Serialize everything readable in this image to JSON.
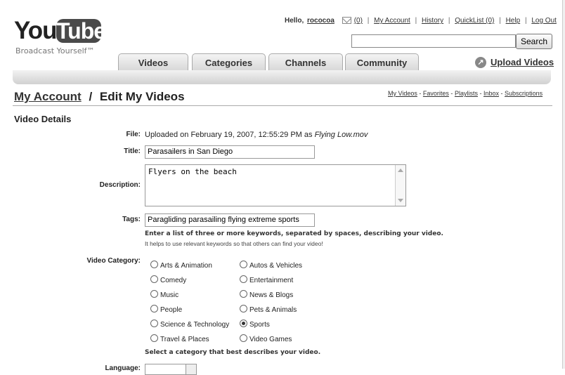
{
  "logo": {
    "part1": "You",
    "part2": "Tube",
    "tagline": "Broadcast Yourself™"
  },
  "user_bar": {
    "hello": "Hello,",
    "username": "rococoa",
    "inbox_count": "(0)",
    "links": [
      "My Account",
      "History",
      "QuickList (0)",
      "Help",
      "Log Out"
    ],
    "separator": "|"
  },
  "search": {
    "value": "",
    "button_label": "Search"
  },
  "tabs": [
    "Videos",
    "Categories",
    "Channels",
    "Community"
  ],
  "upload": {
    "label": "Upload Videos"
  },
  "page": {
    "title_link": "My Account",
    "title_sep": "/",
    "title_rest": "Edit My Videos",
    "subnav": [
      "My Videos",
      "Favorites",
      "Playlists",
      "Inbox",
      "Subscriptions"
    ],
    "subnav_sep": "-"
  },
  "section_title": "Video Details",
  "form": {
    "file_label": "File:",
    "file_value": "Uploaded on February 19, 2007, 12:55:29 PM as ",
    "file_name": "Flying Low.mov",
    "title_label": "Title:",
    "title_value": "Parasailers in San Diego",
    "description_label": "Description:",
    "description_value": "Flyers on the beach",
    "tags_label": "Tags:",
    "tags_value": "Paragliding parasailing flying extreme sports",
    "tags_hint": "Enter a list of three or more keywords, separated by spaces, describing your video.",
    "tags_subhint": "It helps to use relevant keywords so that others can find your video!",
    "category_label": "Video Category:",
    "categories": [
      {
        "label": "Arts & Animation",
        "selected": false
      },
      {
        "label": "Autos & Vehicles",
        "selected": false
      },
      {
        "label": "Comedy",
        "selected": false
      },
      {
        "label": "Entertainment",
        "selected": false
      },
      {
        "label": "Music",
        "selected": false
      },
      {
        "label": "News & Blogs",
        "selected": false
      },
      {
        "label": "People",
        "selected": false
      },
      {
        "label": "Pets & Animals",
        "selected": false
      },
      {
        "label": "Science & Technology",
        "selected": false
      },
      {
        "label": "Sports",
        "selected": true
      },
      {
        "label": "Travel & Places",
        "selected": false
      },
      {
        "label": "Video Games",
        "selected": false
      }
    ],
    "category_hint": "Select a category that best describes your video.",
    "language_label": "Language:"
  }
}
